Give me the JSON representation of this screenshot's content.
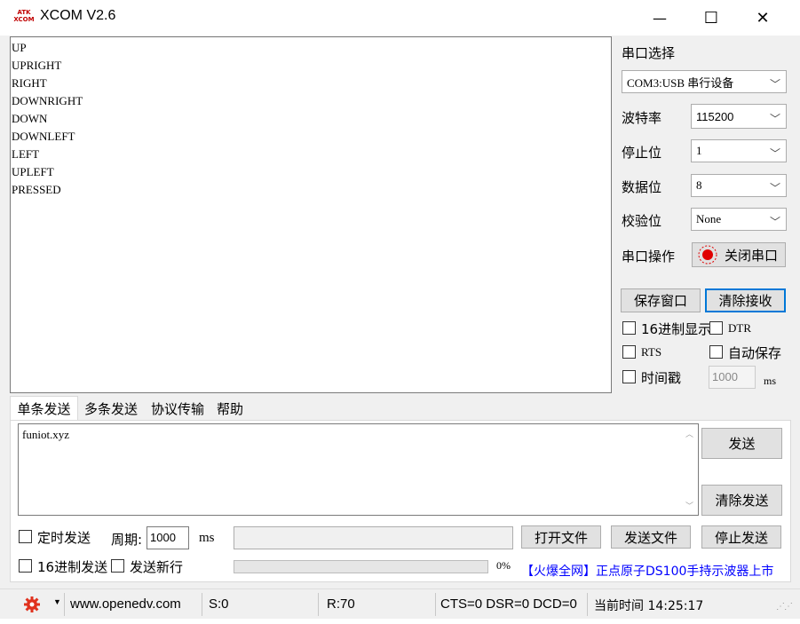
{
  "window": {
    "logo_top": "ATK",
    "logo_bottom": "XCOM",
    "title": "XCOM V2.6",
    "minimize_glyph": "—",
    "maximize_glyph": "☐",
    "close_glyph": "✕"
  },
  "receive": {
    "lines": "UP\nUPRIGHT\nRIGHT\nDOWNRIGHT\nDOWN\nDOWNLEFT\nLEFT\nUPLEFT\nPRESSED"
  },
  "settings": {
    "port_select_label": "串口选择",
    "port_value": "COM3:USB 串行设备",
    "baud_label": "波特率",
    "baud_value": "115200",
    "stopbits_label": "停止位",
    "stopbits_value": "1",
    "databits_label": "数据位",
    "databits_value": "8",
    "parity_label": "校验位",
    "parity_value": "None",
    "port_op_label": "串口操作",
    "close_port_label": "关闭串口",
    "save_window_label": "保存窗口",
    "clear_receive_label": "清除接收",
    "hex_display_label": "16进制显示",
    "dtr_label": "DTR",
    "rts_label": "RTS",
    "auto_save_label": "自动保存",
    "timestamp_label": "时间戳",
    "timestamp_ms_value": "1000",
    "ms_unit": "ms"
  },
  "tabs": [
    {
      "label": "单条发送"
    },
    {
      "label": "多条发送"
    },
    {
      "label": "协议传输"
    },
    {
      "label": "帮助"
    }
  ],
  "send": {
    "text": "funiot.xyz",
    "send_label": "发送",
    "clear_send_label": "清除发送",
    "timed_send_label": "定时发送",
    "period_label": "周期:",
    "period_value": "1000",
    "period_unit": "ms",
    "open_file_label": "打开文件",
    "send_file_label": "发送文件",
    "stop_send_label": "停止发送",
    "hex_send_label": "16进制发送",
    "newline_label": "发送新行",
    "progress_percent": "0%",
    "ad_text": "【火爆全网】正点原子DS100手持示波器上市"
  },
  "status": {
    "website": "www.openedv.com",
    "sent": "S:0",
    "received": "R:70",
    "lines": "CTS=0 DSR=0 DCD=0",
    "time": "当前时间 14:25:17"
  },
  "colors": {
    "accent_blue": "#0078d7",
    "ad_blue": "#0000ff",
    "record_red": "#e00000",
    "gear_red": "#e0321e"
  }
}
